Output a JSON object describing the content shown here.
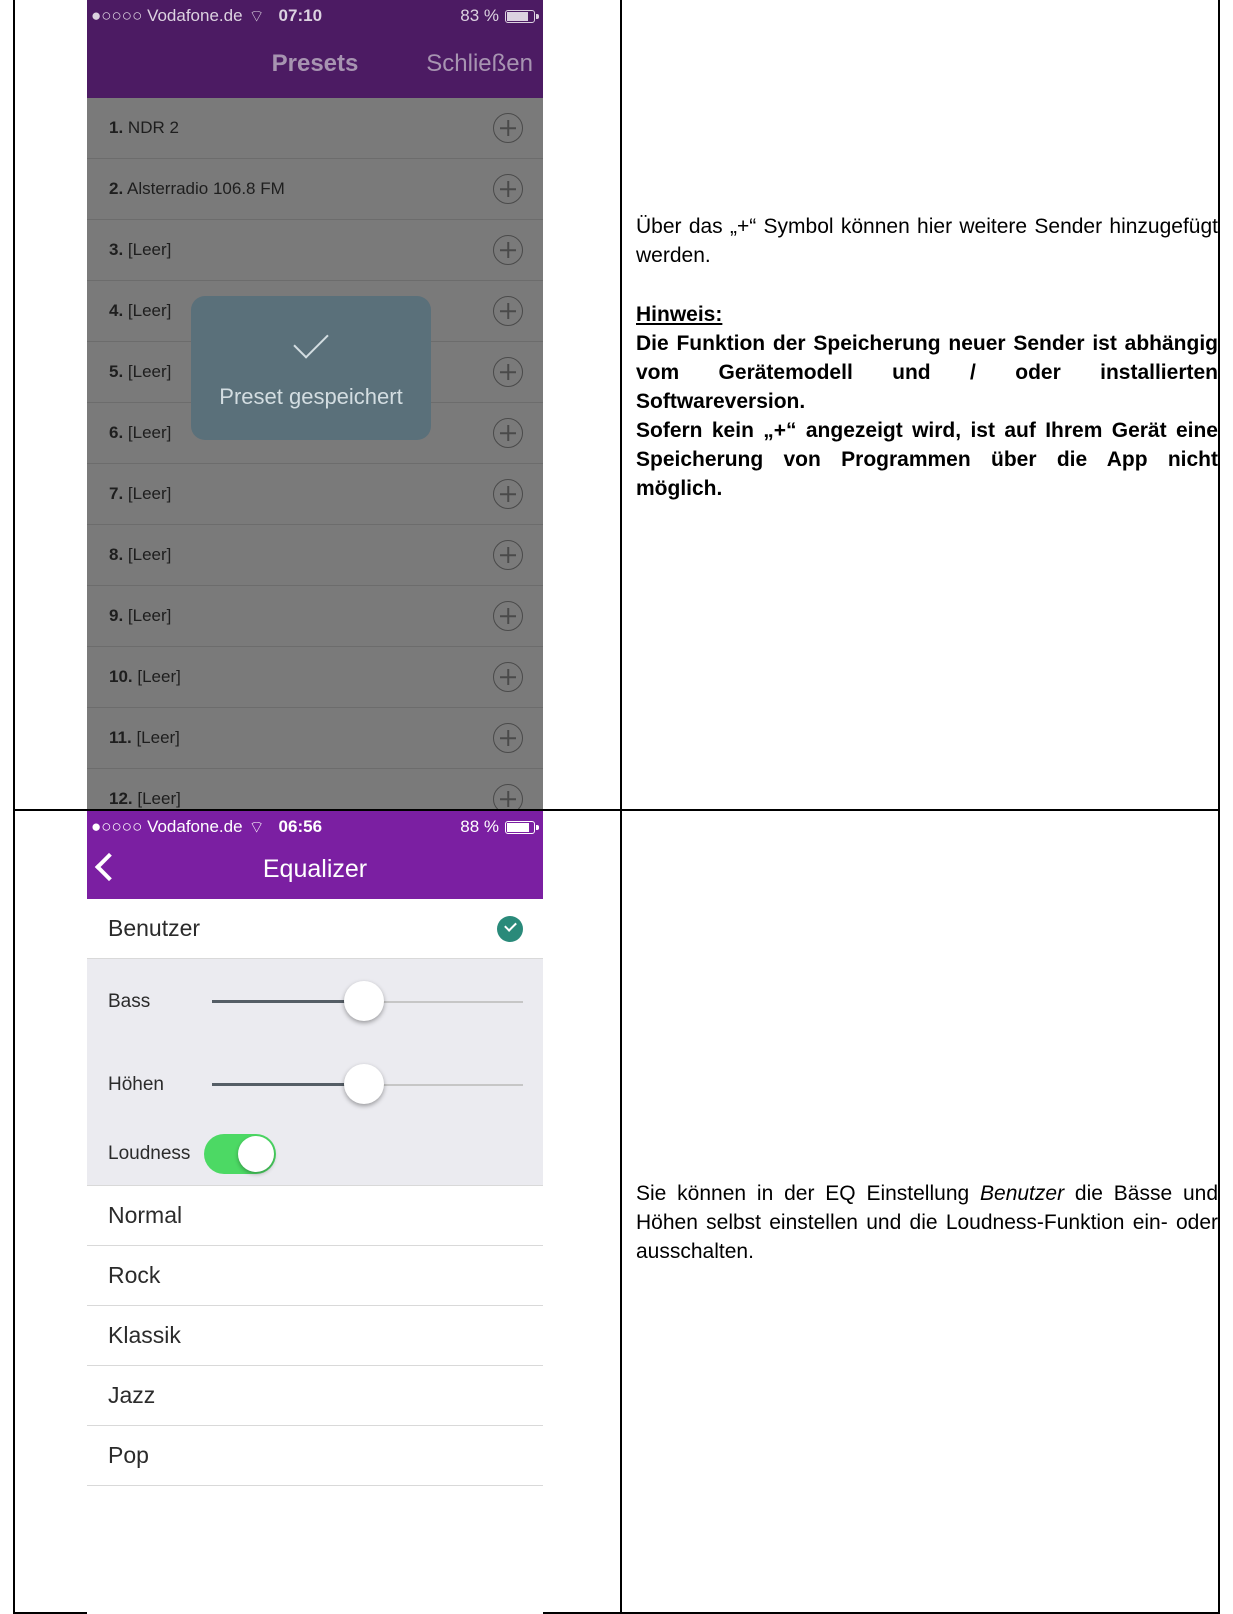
{
  "screen1": {
    "status": {
      "carrier": "●○○○○ Vodafone.de",
      "time": "07:10",
      "battery": "83 %",
      "battery_level": 0.83
    },
    "nav": {
      "title": "Presets",
      "close_label": "Schließen"
    },
    "presets": [
      {
        "num": "1.",
        "name": "NDR 2"
      },
      {
        "num": "2.",
        "name": "Alsterradio 106.8 FM"
      },
      {
        "num": "3.",
        "name": "[Leer]"
      },
      {
        "num": "4.",
        "name": "[Leer]"
      },
      {
        "num": "5.",
        "name": "[Leer]"
      },
      {
        "num": "6.",
        "name": "[Leer]"
      },
      {
        "num": "7.",
        "name": "[Leer]"
      },
      {
        "num": "8.",
        "name": "[Leer]"
      },
      {
        "num": "9.",
        "name": "[Leer]"
      },
      {
        "num": "10.",
        "name": "[Leer]"
      },
      {
        "num": "11.",
        "name": "[Leer]"
      },
      {
        "num": "12.",
        "name": "[Leer]"
      }
    ],
    "toast": "Preset gespeichert"
  },
  "screen2": {
    "status": {
      "carrier": "●○○○○ Vodafone.de",
      "time": "06:56",
      "battery": "88 %",
      "battery_level": 0.88
    },
    "nav": {
      "title": "Equalizer"
    },
    "selected_preset": "Benutzer",
    "bass": {
      "label": "Bass",
      "level": 0.49
    },
    "treble": {
      "label": "Höhen",
      "level": 0.49
    },
    "loudness": {
      "label": "Loudness",
      "on": true
    },
    "presets": [
      "Normal",
      "Rock",
      "Klassik",
      "Jazz",
      "Pop"
    ]
  },
  "text1": {
    "intro": "Über das „+“ Symbol können hier weitere Sender hinzugefügt werden.",
    "hint_title": "Hinweis:",
    "hint_body": "Die Funktion der Speicherung neuer Sender ist abhängig vom Gerätemodell und / oder installierten Softwareversion.",
    "hint_body2": "Sofern kein „+“ angezeigt wird, ist auf Ihrem Gerät eine Speicherung von Programmen über die App nicht möglich."
  },
  "text2": {
    "part1": "Sie können in der EQ Einstellung ",
    "emph": "Benutzer",
    "part2": " die Bässe und Höhen selbst einstellen und die Loudness-Funktion ein- oder ausschalten."
  },
  "colors": {
    "nav_purple_dim": "#4c1b63",
    "nav_purple": "#7b1fa2",
    "toggle_green": "#4cd964",
    "check_teal": "#2a8a7a"
  }
}
